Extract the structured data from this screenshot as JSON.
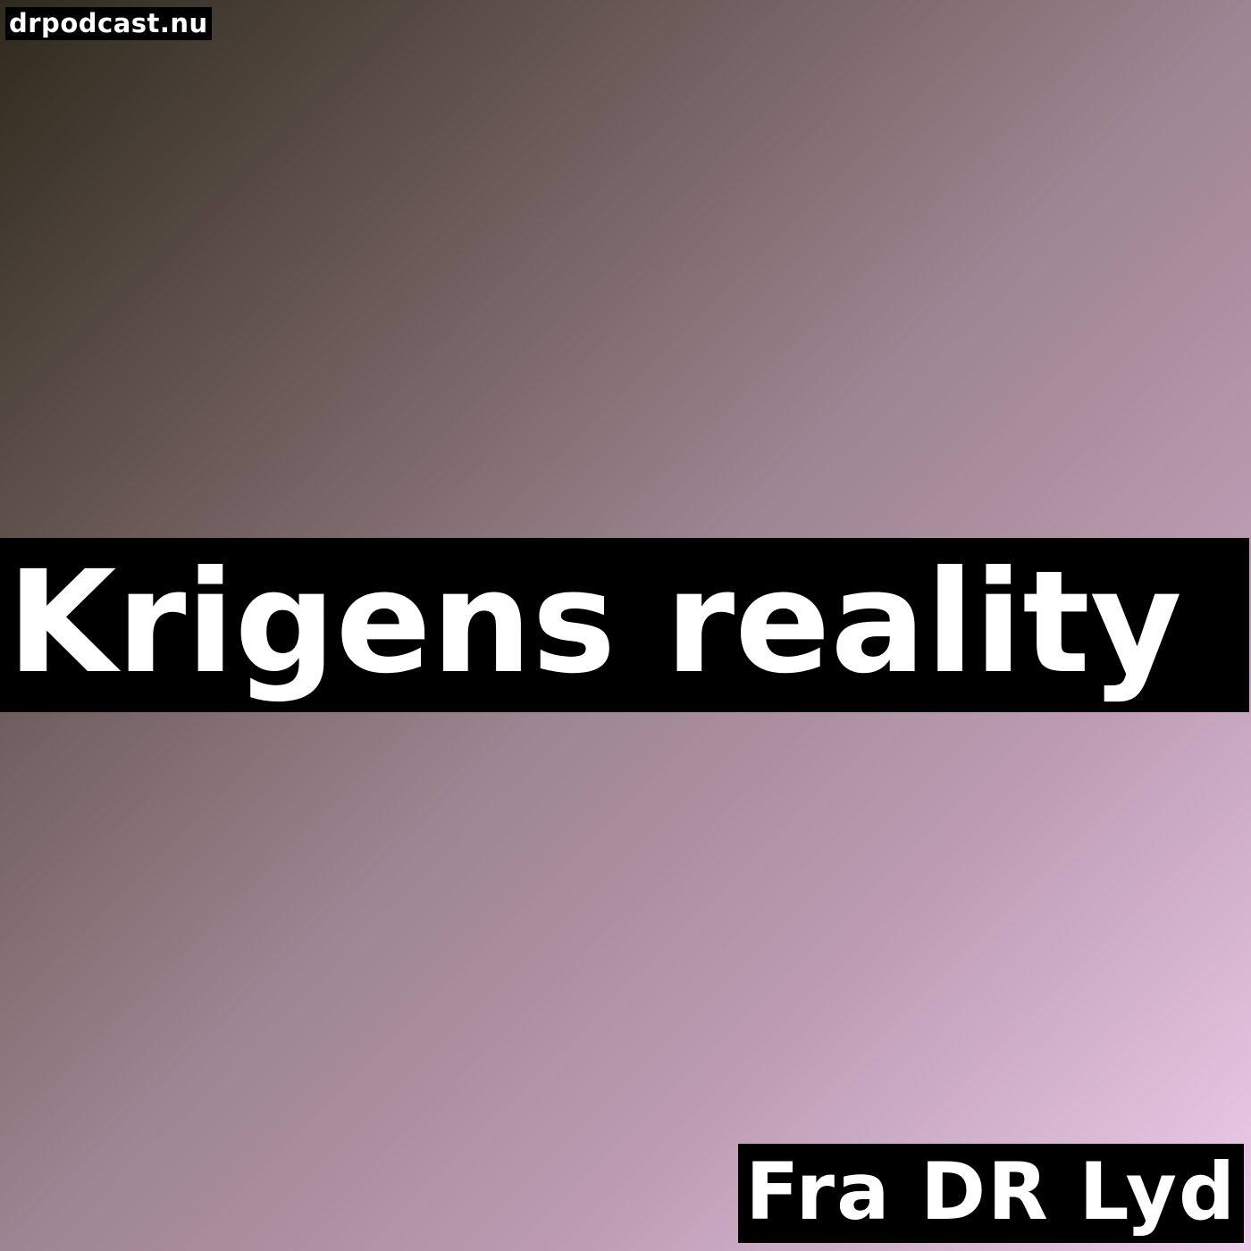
{
  "site_tag": "drpodcast.nu",
  "title": "Krigens reality",
  "source": "Fra DR Lyd",
  "colors": {
    "gradient_start": "#2e2a1c",
    "gradient_end": "#efcdec",
    "band": "#000000",
    "text": "#ffffff"
  }
}
